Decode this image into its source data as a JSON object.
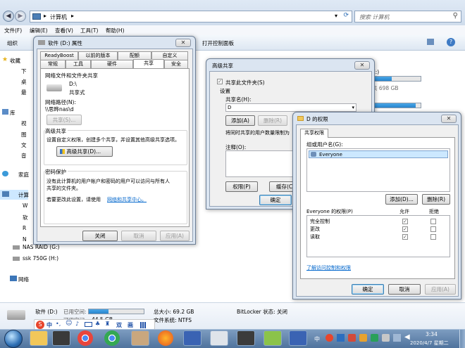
{
  "explorer": {
    "address_root": "计算机",
    "search_placeholder": "搜索 计算机",
    "menu": [
      "文件(F)",
      "编辑(E)",
      "查看(V)",
      "工具(T)",
      "帮助(H)"
    ],
    "toolbar_left": "组织",
    "toolbar_control_panel": "打开控制面板",
    "sidebar": [
      "收藏",
      "下",
      "桌",
      "最",
      "库",
      "视",
      "图",
      "文",
      "音",
      "家庭",
      "计算",
      "W",
      "软",
      "R",
      "N",
      "NAS RAID (G:)",
      "ssk 750G (H:)",
      "网络"
    ],
    "drive_free": "共 698 GB",
    "drive_letter_hint": "E:)",
    "status_name": "软件 (D:)",
    "status_used_label": "已用空间:",
    "status_total": "总大小: 69.2 GB",
    "status_fs": "文件系统: NTFS",
    "status_free_label": "可用空间:",
    "status_free": "44.5 GB",
    "status_bitlocker": "BitLocker 状态: 关闭",
    "status_used_fraction": 0.36
  },
  "props": {
    "title": "软件 (D:) 属性",
    "tabs_row1": [
      "ReadyBoost",
      "以前的版本",
      "配额",
      "自定义"
    ],
    "tabs_row2": [
      "常规",
      "工具",
      "硬件",
      "共享",
      "安全"
    ],
    "active_tab": "共享",
    "net_section": "网络文件和文件夹共享",
    "drive_path": "D:\\",
    "drive_state": "共享式",
    "net_path_label": "网络路径(N):",
    "net_path": "\\\\思晔nas\\d",
    "share_btn": "共享(S)...",
    "adv_section": "高级共享",
    "adv_desc": "设置自定义权限，创建多个共享，并设置其他高级共享选项。",
    "adv_btn": "高级共享(D)...",
    "pw_section": "密码保护",
    "pw_desc1": "没有此计算机的用户帐户和密码的用户可以访问与所有人",
    "pw_desc2": "共享的文件夹。",
    "pw_desc3": "若要更改此设置，请使用",
    "pw_link": "网络和共享中心。",
    "close_btn": "关闭",
    "cancel_btn": "取消",
    "apply_btn": "应用(A)"
  },
  "adv": {
    "title": "高级共享",
    "share_check": "共享此文件夹(S)",
    "settings": "设置",
    "share_name_label": "共享名(H):",
    "share_name": "D",
    "add_btn": "添加(A)",
    "remove_btn": "删除(R)",
    "limit_text": "将同时共享的用户数量限制为",
    "comment_label": "注释(O):",
    "perm_btn": "权限(P)",
    "cache_btn": "缓存(C)",
    "ok_btn": "确定"
  },
  "perm": {
    "title": "D 的权限",
    "tab": "共享权限",
    "group_label": "组或用户名(G):",
    "users": [
      "Everyone"
    ],
    "add_btn": "添加(D)...",
    "remove_btn": "删除(R)",
    "perm_for": "Everyone 的权限(P)",
    "allow": "允许",
    "deny": "拒绝",
    "rows": [
      {
        "name": "完全控制",
        "allow": true,
        "deny": false
      },
      {
        "name": "更改",
        "allow": true,
        "deny": false
      },
      {
        "name": "读取",
        "allow": true,
        "deny": false
      }
    ],
    "link": "了解访问控制和权限",
    "ok_btn": "确定",
    "cancel_btn": "取消",
    "apply_btn": "应用(A)"
  },
  "ime": {
    "lang": "中",
    "items": [
      "双",
      "画"
    ]
  },
  "taskbar": {
    "time": "3:34",
    "date": "2020/4/7 星期二",
    "colors": {
      "bar": "#5b7fa7",
      "accent": "#1c5f9e"
    }
  }
}
